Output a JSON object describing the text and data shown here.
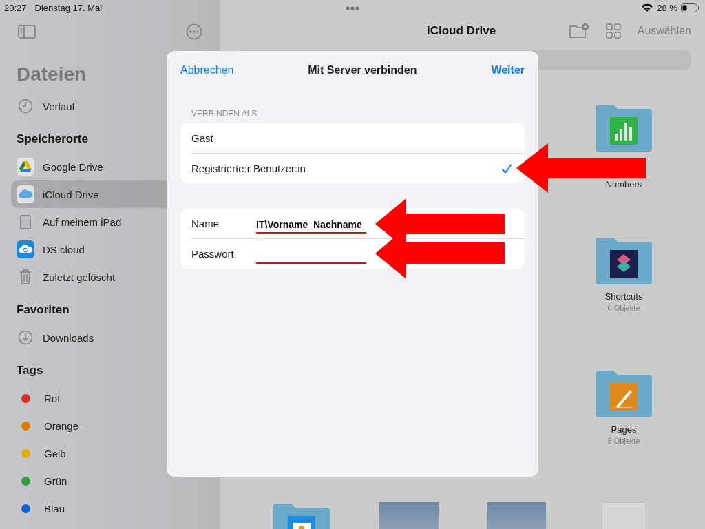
{
  "status_bar": {
    "time": "20:27",
    "date": "Dienstag 17. Mai",
    "battery": "28 %"
  },
  "sidebar": {
    "title": "Dateien",
    "top_items": [
      {
        "label": "Verlauf",
        "kind": "clock",
        "selected": false
      }
    ],
    "sections": [
      {
        "title": "Speicherorte",
        "items": [
          {
            "label": "Google Drive",
            "kind": "gdrive",
            "selected": false
          },
          {
            "label": "iCloud Drive",
            "kind": "icloud",
            "selected": true
          },
          {
            "label": "Auf meinem iPad",
            "kind": "ipad",
            "selected": false
          },
          {
            "label": "DS cloud",
            "kind": "dscloud",
            "selected": false
          },
          {
            "label": "Zuletzt gelöscht",
            "kind": "trash",
            "selected": false
          }
        ]
      },
      {
        "title": "Favoriten",
        "items": [
          {
            "label": "Downloads",
            "kind": "download",
            "selected": false
          }
        ]
      },
      {
        "title": "Tags",
        "items": [
          {
            "label": "Rot",
            "kind": "tag",
            "color": "#d93025",
            "selected": false
          },
          {
            "label": "Orange",
            "kind": "tag",
            "color": "#e07b00",
            "selected": false
          },
          {
            "label": "Gelb",
            "kind": "tag",
            "color": "#e0b000",
            "selected": false
          },
          {
            "label": "Grün",
            "kind": "tag",
            "color": "#2ea043",
            "selected": false
          },
          {
            "label": "Blau",
            "kind": "tag",
            "color": "#0a64d8",
            "selected": false
          }
        ]
      }
    ]
  },
  "main": {
    "title": "iCloud Drive",
    "select_button": "Auswählen",
    "items": [
      {
        "kind": "numbers_folder",
        "name": "Numbers"
      },
      {
        "kind": "shortcuts_folder",
        "name": "Shortcuts",
        "count": "0 Objekte"
      },
      {
        "kind": "pages_folder",
        "name": "Pages",
        "count": "8 Objekte"
      },
      {
        "kind": "keynote_folder"
      },
      {
        "kind": "photo"
      },
      {
        "kind": "photo"
      },
      {
        "kind": "document"
      }
    ]
  },
  "dialog": {
    "cancel": "Abbrechen",
    "title": "Mit Server verbinden",
    "next": "Weiter",
    "section_header": "VERBINDEN ALS",
    "options": [
      {
        "label": "Gast",
        "selected": false
      },
      {
        "label": "Registrierte:r Benutzer:in",
        "selected": true
      }
    ],
    "fields": [
      {
        "label": "Name",
        "value": "IT\\Vorname_Nachname"
      },
      {
        "label": "Passwort"
      }
    ]
  }
}
